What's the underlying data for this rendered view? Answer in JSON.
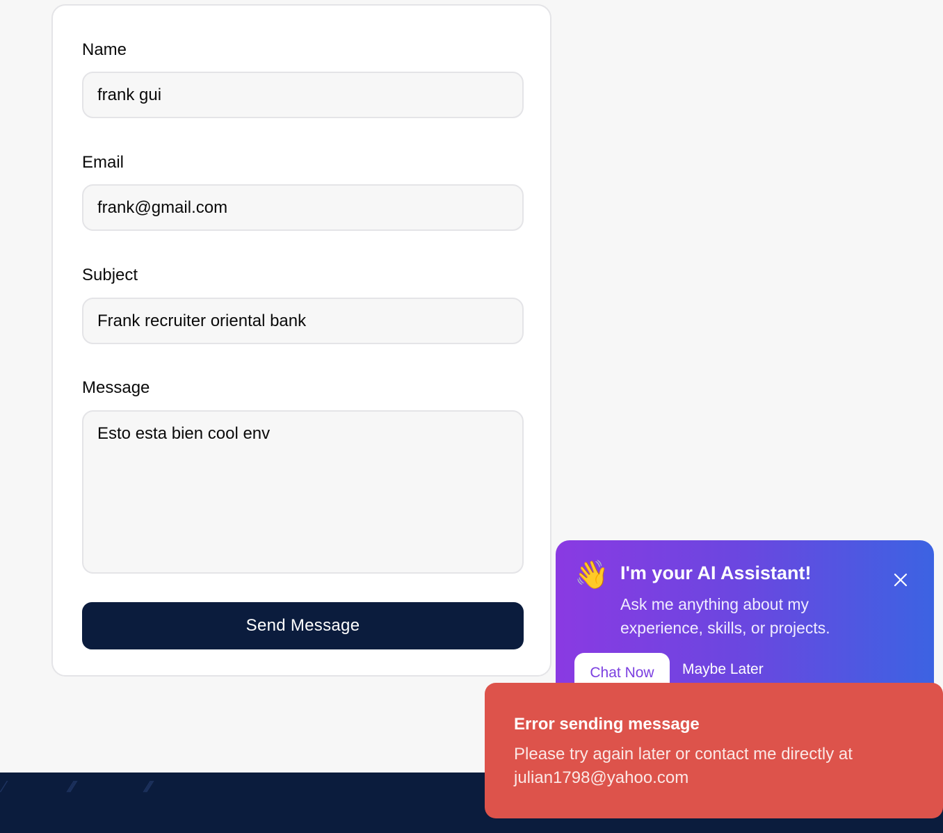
{
  "form": {
    "name": {
      "label": "Name",
      "value": "frank gui"
    },
    "email": {
      "label": "Email",
      "value": "frank@gmail.com"
    },
    "subject": {
      "label": "Subject",
      "value": "Frank recruiter oriental bank"
    },
    "message": {
      "label": "Message",
      "value": "Esto esta bien cool env"
    },
    "submit_label": "Send Message"
  },
  "assistant": {
    "icon": "waving-hand-icon",
    "emoji": "👋",
    "title": "I'm your AI Assistant!",
    "text": "Ask me anything about my experience, skills, or projects.",
    "chat_label": "Chat Now",
    "later_label": "Maybe Later"
  },
  "toast": {
    "title": "Error sending message",
    "message": "Please try again later or contact me directly at julian1798@yahoo.com"
  },
  "colors": {
    "navy": "#0b1c3d",
    "error": "#dd534b",
    "gradient_start": "#8a3ae2",
    "gradient_end": "#3c63e2"
  }
}
